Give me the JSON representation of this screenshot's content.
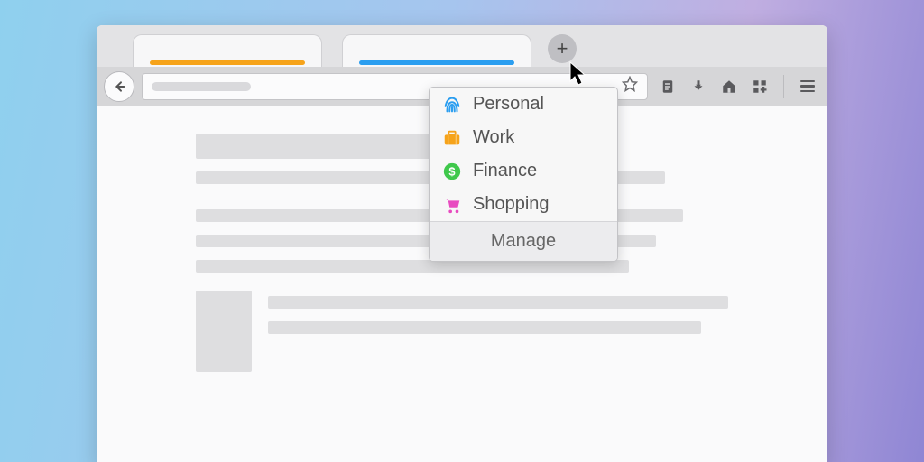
{
  "tabs": [
    {
      "accent": "#f6a31a"
    },
    {
      "accent": "#2b9ef0"
    }
  ],
  "newtab_glyph": "+",
  "containers": {
    "items": [
      {
        "label": "Personal",
        "color": "#2b9ef0",
        "icon": "fingerprint"
      },
      {
        "label": "Work",
        "color": "#f6a31a",
        "icon": "briefcase"
      },
      {
        "label": "Finance",
        "color": "#3fc84b",
        "icon": "dollar"
      },
      {
        "label": "Shopping",
        "color": "#e84bc0",
        "icon": "cart"
      }
    ],
    "manage_label": "Manage"
  }
}
